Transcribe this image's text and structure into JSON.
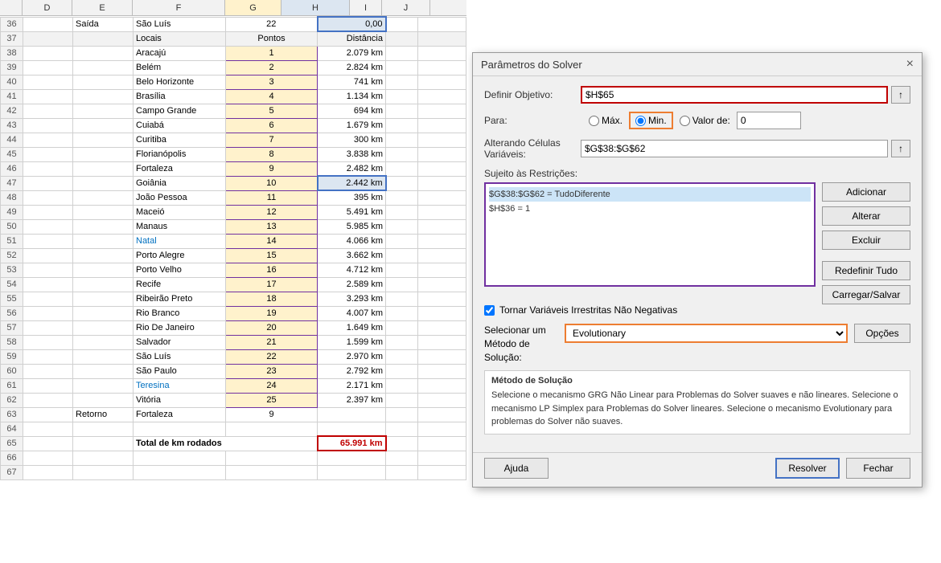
{
  "spreadsheet": {
    "col_headers": [
      "D",
      "E",
      "F",
      "G",
      "H",
      "I",
      "J"
    ],
    "rows": [
      {
        "num": 36,
        "d": "",
        "e": "Saída",
        "f": "São Luís",
        "g": "22",
        "h": "0,00",
        "i": "",
        "j": ""
      },
      {
        "num": 37,
        "d": "",
        "e": "",
        "f": "Locais",
        "g": "Pontos",
        "h": "Distância",
        "i": "",
        "j": ""
      },
      {
        "num": 38,
        "d": "",
        "e": "",
        "f": "Aracajú",
        "g": "1",
        "h": "2.079 km",
        "i": "",
        "j": ""
      },
      {
        "num": 39,
        "d": "",
        "e": "",
        "f": "Belém",
        "g": "2",
        "h": "2.824 km",
        "i": "",
        "j": ""
      },
      {
        "num": 40,
        "d": "",
        "e": "",
        "f": "Belo Horizonte",
        "g": "3",
        "h": "741 km",
        "i": "",
        "j": ""
      },
      {
        "num": 41,
        "d": "",
        "e": "",
        "f": "Brasília",
        "g": "4",
        "h": "1.134 km",
        "i": "",
        "j": ""
      },
      {
        "num": 42,
        "d": "",
        "e": "",
        "f": "Campo Grande",
        "g": "5",
        "h": "694 km",
        "i": "",
        "j": ""
      },
      {
        "num": 43,
        "d": "",
        "e": "",
        "f": "Cuiabá",
        "g": "6",
        "h": "1.679 km",
        "i": "",
        "j": ""
      },
      {
        "num": 44,
        "d": "",
        "e": "",
        "f": "Curitiba",
        "g": "7",
        "h": "300 km",
        "i": "",
        "j": ""
      },
      {
        "num": 45,
        "d": "",
        "e": "",
        "f": "Florianópolis",
        "g": "8",
        "h": "3.838 km",
        "i": "",
        "j": ""
      },
      {
        "num": 46,
        "d": "",
        "e": "",
        "f": "Fortaleza",
        "g": "9",
        "h": "2.482 km",
        "i": "",
        "j": ""
      },
      {
        "num": 47,
        "d": "",
        "e": "",
        "f": "Goiânia",
        "g": "10",
        "h": "2.442 km",
        "i": "",
        "j": "",
        "highlight_h": true
      },
      {
        "num": 48,
        "d": "",
        "e": "",
        "f": "João Pessoa",
        "g": "11",
        "h": "395 km",
        "i": "",
        "j": ""
      },
      {
        "num": 49,
        "d": "",
        "e": "",
        "f": "Maceió",
        "g": "12",
        "h": "5.491 km",
        "i": "",
        "j": ""
      },
      {
        "num": 50,
        "d": "",
        "e": "",
        "f": "Manaus",
        "g": "13",
        "h": "5.985 km",
        "i": "",
        "j": ""
      },
      {
        "num": 51,
        "d": "",
        "e": "",
        "f": "Natal",
        "g": "14",
        "h": "4.066 km",
        "i": "",
        "j": "",
        "f_blue": true
      },
      {
        "num": 52,
        "d": "",
        "e": "",
        "f": "Porto Alegre",
        "g": "15",
        "h": "3.662 km",
        "i": "",
        "j": ""
      },
      {
        "num": 53,
        "d": "",
        "e": "",
        "f": "Porto Velho",
        "g": "16",
        "h": "4.712 km",
        "i": "",
        "j": ""
      },
      {
        "num": 54,
        "d": "",
        "e": "",
        "f": "Recife",
        "g": "17",
        "h": "2.589 km",
        "i": "",
        "j": ""
      },
      {
        "num": 55,
        "d": "",
        "e": "",
        "f": "Ribeirão Preto",
        "g": "18",
        "h": "3.293 km",
        "i": "",
        "j": ""
      },
      {
        "num": 56,
        "d": "",
        "e": "",
        "f": "Rio Branco",
        "g": "19",
        "h": "4.007 km",
        "i": "",
        "j": ""
      },
      {
        "num": 57,
        "d": "",
        "e": "",
        "f": "Rio De Janeiro",
        "g": "20",
        "h": "1.649 km",
        "i": "",
        "j": ""
      },
      {
        "num": 58,
        "d": "",
        "e": "",
        "f": "Salvador",
        "g": "21",
        "h": "1.599 km",
        "i": "",
        "j": ""
      },
      {
        "num": 59,
        "d": "",
        "e": "",
        "f": "São Luís",
        "g": "22",
        "h": "2.970 km",
        "i": "",
        "j": ""
      },
      {
        "num": 60,
        "d": "",
        "e": "",
        "f": "São Paulo",
        "g": "23",
        "h": "2.792 km",
        "i": "",
        "j": ""
      },
      {
        "num": 61,
        "d": "",
        "e": "",
        "f": "Teresina",
        "g": "24",
        "h": "2.171 km",
        "i": "",
        "j": "",
        "f_blue": true
      },
      {
        "num": 62,
        "d": "",
        "e": "",
        "f": "Vitória",
        "g": "25",
        "h": "2.397 km",
        "i": "",
        "j": ""
      },
      {
        "num": 63,
        "d": "",
        "e": "Retorno",
        "f": "Fortaleza",
        "g": "9",
        "h": "",
        "i": "",
        "j": ""
      },
      {
        "num": 64,
        "d": "",
        "e": "",
        "f": "",
        "g": "",
        "h": "",
        "i": "",
        "j": ""
      },
      {
        "num": 65,
        "d": "",
        "e": "",
        "f": "Total de km rodados",
        "g": "",
        "h": "65.991 km",
        "i": "",
        "j": "",
        "total": true
      },
      {
        "num": 66,
        "d": "",
        "e": "",
        "f": "",
        "g": "",
        "h": "",
        "i": "",
        "j": ""
      },
      {
        "num": 67,
        "d": "",
        "e": "",
        "f": "",
        "g": "",
        "h": "",
        "i": "",
        "j": ""
      }
    ]
  },
  "dialog": {
    "title": "Parâmetros do Solver",
    "close_label": "×",
    "definir_objetivo_label": "Definir Objetivo:",
    "definir_objetivo_value": "$H$65",
    "para_label": "Para:",
    "radio_max": "Máx.",
    "radio_min": "Min.",
    "radio_valor_de": "Valor de:",
    "valor_de_value": "0",
    "alterando_label": "Alterando Células Variáveis:",
    "alterando_value": "$G$38:$G$62",
    "sujeito_label": "Sujeito às Restrições:",
    "constraints": [
      "$G$38:$G$62 = TudoDiferente",
      "$H$36 = 1"
    ],
    "btn_adicionar": "Adicionar",
    "btn_alterar": "Alterar",
    "btn_excluir": "Excluir",
    "btn_redefinir": "Redefinir Tudo",
    "btn_carregar": "Carregar/Salvar",
    "checkbox_label": "Tornar Variáveis Irrestritas Não Negativas",
    "selecionar_label": "Selecionar um\nMétodo de\nSolução:",
    "method_value": "Evolutionary",
    "btn_opcoes": "Opções",
    "method_desc_title": "Método de Solução",
    "method_desc": "Selecione o mecanismo GRG Não Linear para Problemas do Solver suaves e não lineares. Selecione o mecanismo LP Simplex para Problemas do Solver lineares. Selecione o mecanismo Evolutionary para problemas do Solver não suaves.",
    "btn_ajuda": "Ajuda",
    "btn_resolver": "Resolver",
    "btn_fechar": "Fechar"
  }
}
